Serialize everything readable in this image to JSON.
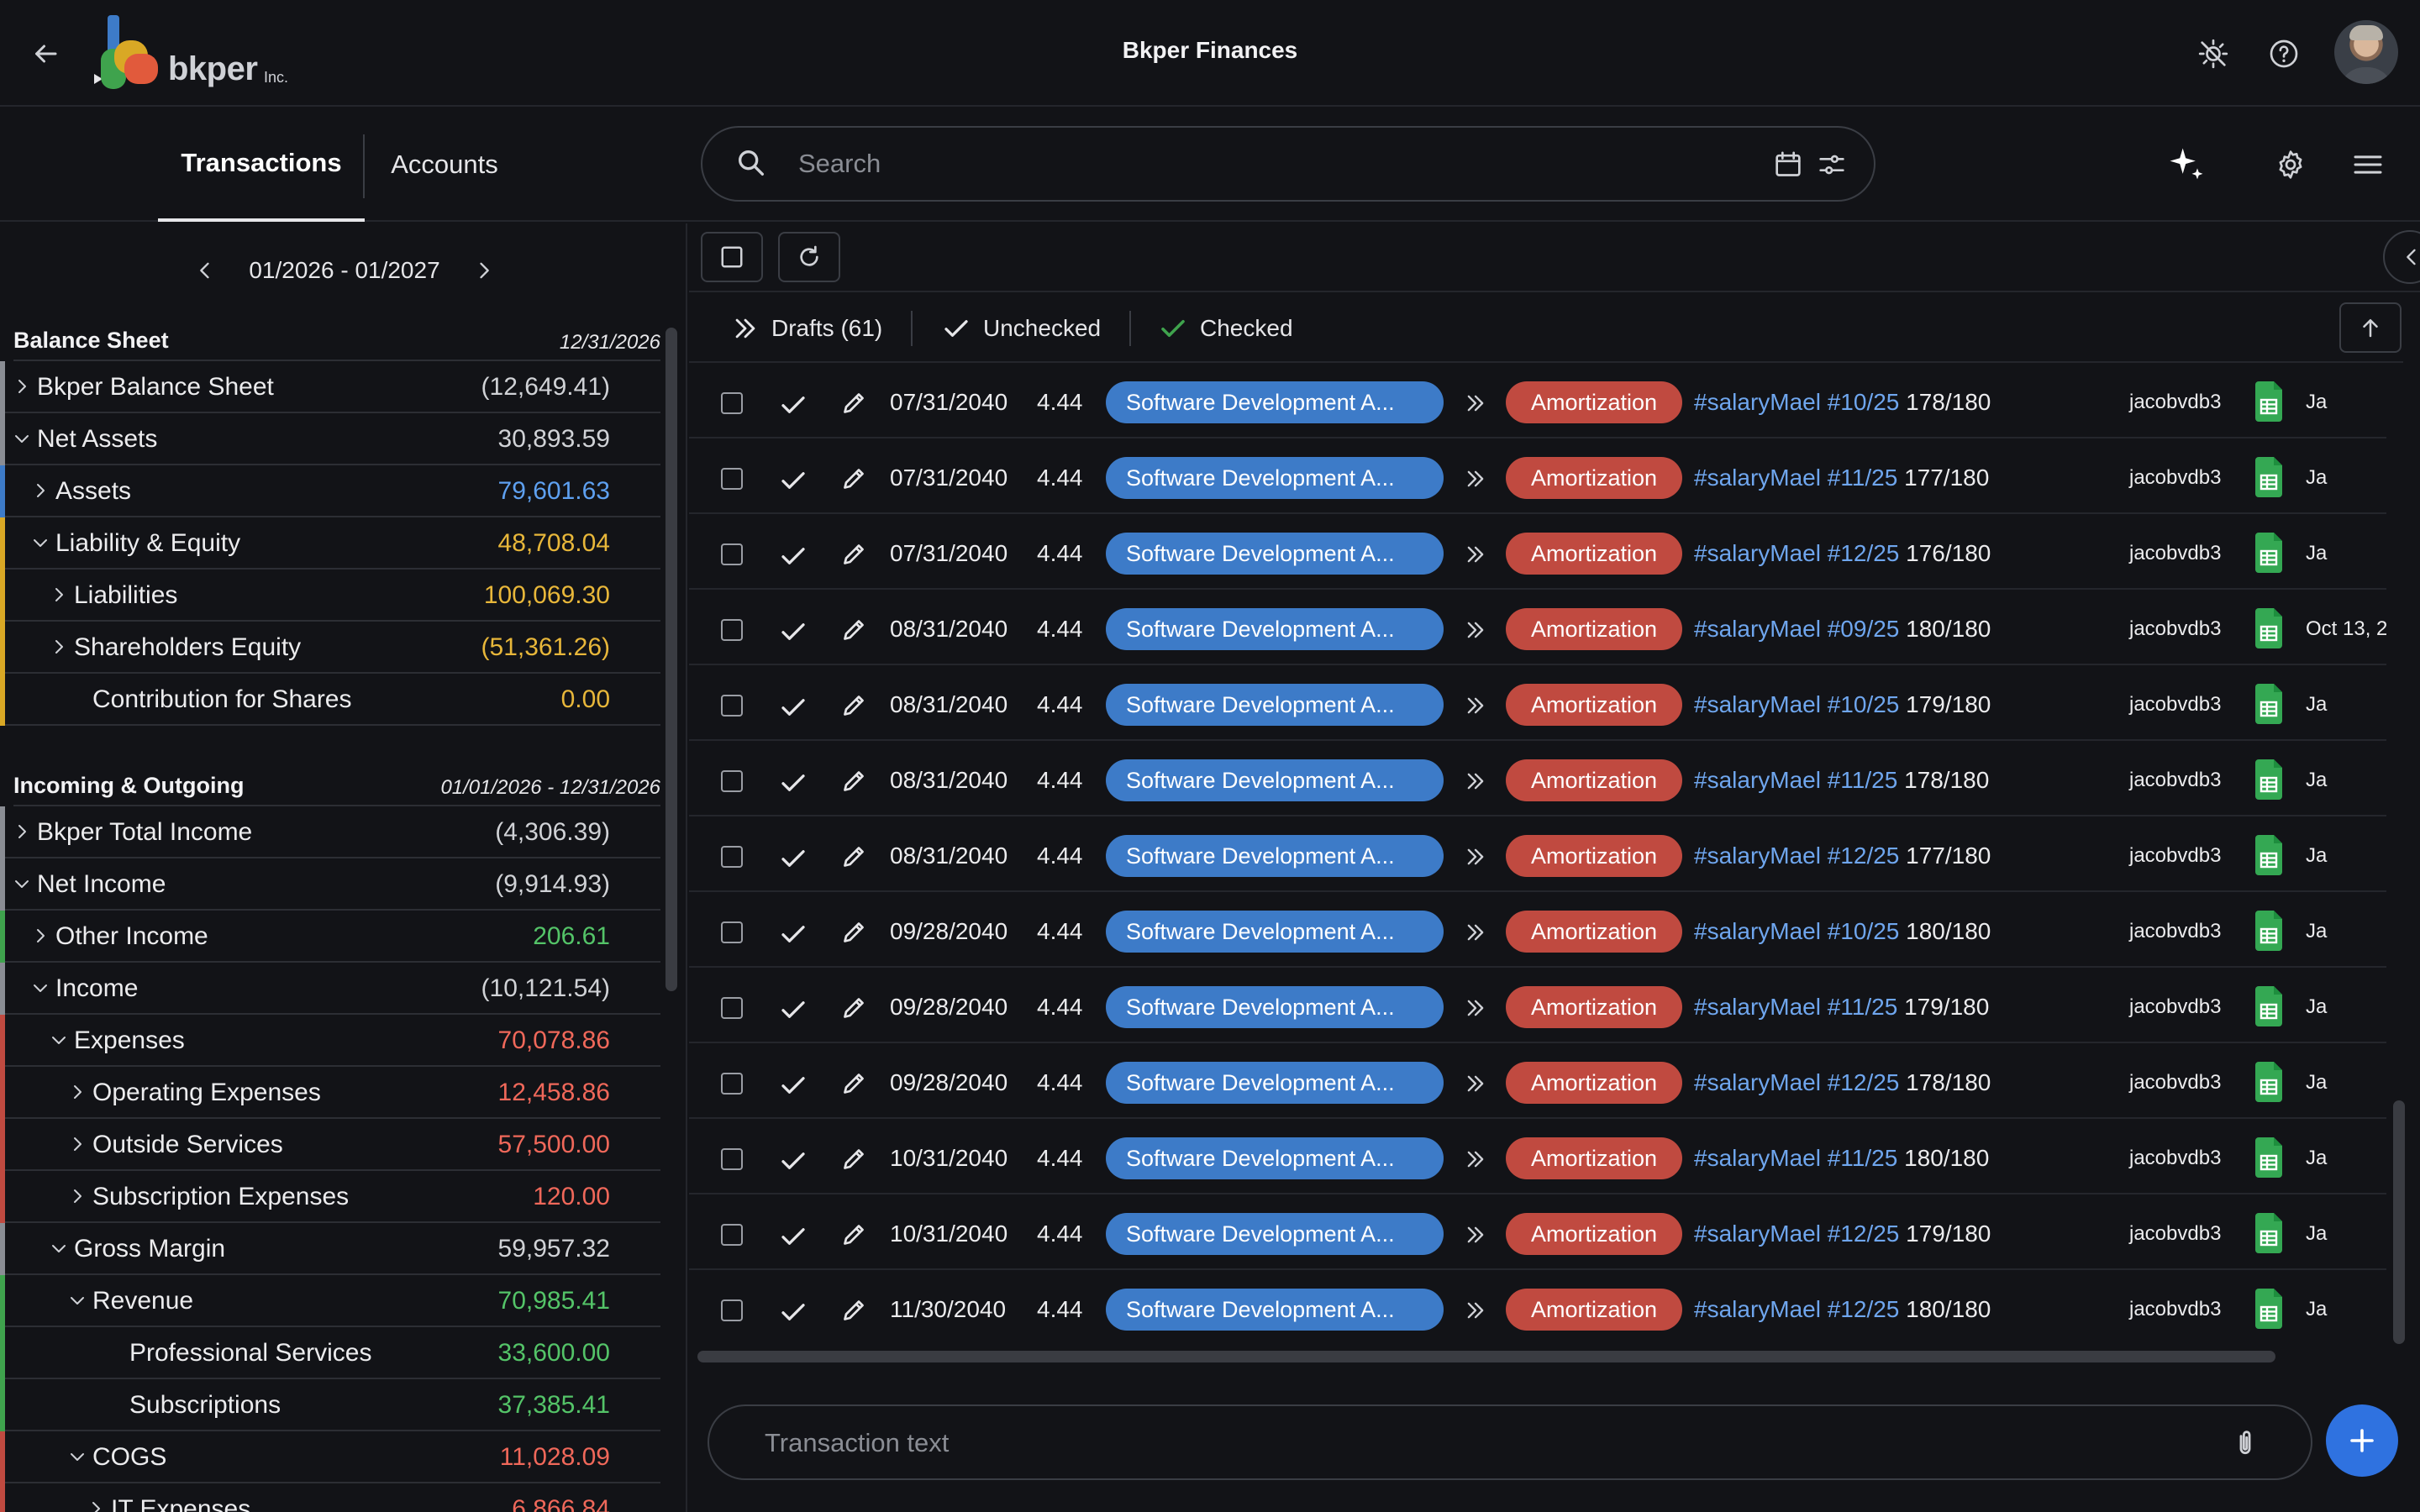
{
  "app": {
    "title": "Bkper Finances",
    "logo_word": "bkper",
    "logo_suffix": "Inc."
  },
  "tabs": {
    "transactions": "Transactions",
    "accounts": "Accounts"
  },
  "search": {
    "placeholder": "Search",
    "value": ""
  },
  "period": {
    "label": "01/2026 - 01/2027"
  },
  "balance_sheet": {
    "title": "Balance Sheet",
    "date": "12/31/2026",
    "accounts": [
      {
        "name": "Bkper Balance Sheet",
        "value": "(12,649.41)",
        "level": 0,
        "chevron": "right",
        "bar_color": "#8a8d94",
        "value_color": "#d0d2d6"
      },
      {
        "name": "Net Assets",
        "value": "30,893.59",
        "level": 0,
        "chevron": "down",
        "bar_color": "#8a8d94",
        "value_color": "#d0d2d6"
      },
      {
        "name": "Assets",
        "value": "79,601.63",
        "level": 1,
        "chevron": "right",
        "bar_color": "#3d7bc8",
        "value_color": "#5ea0f0"
      },
      {
        "name": "Liability & Equity",
        "value": "48,708.04",
        "level": 1,
        "chevron": "down",
        "bar_color": "#d9a825",
        "value_color": "#e8b73a"
      },
      {
        "name": "Liabilities",
        "value": "100,069.30",
        "level": 2,
        "chevron": "right",
        "bar_color": "#d9a825",
        "value_color": "#e8b73a"
      },
      {
        "name": "Shareholders Equity",
        "value": "(51,361.26)",
        "level": 2,
        "chevron": "right",
        "bar_color": "#d9a825",
        "value_color": "#e8b73a"
      },
      {
        "name": "Contribution for Shares",
        "value": "0.00",
        "level": 3,
        "chevron": "none",
        "bar_color": "#d9a825",
        "value_color": "#e8b73a"
      }
    ]
  },
  "incoming_outgoing": {
    "title": "Incoming & Outgoing",
    "date": "01/01/2026 - 12/31/2026",
    "accounts": [
      {
        "name": "Bkper Total Income",
        "value": "(4,306.39)",
        "level": 0,
        "chevron": "right",
        "bar_color": "#8a8d94",
        "value_color": "#d0d2d6"
      },
      {
        "name": "Net Income",
        "value": "(9,914.93)",
        "level": 0,
        "chevron": "down",
        "bar_color": "#8a8d94",
        "value_color": "#d0d2d6"
      },
      {
        "name": "Other Income",
        "value": "206.61",
        "level": 1,
        "chevron": "right",
        "bar_color": "#3fa34d",
        "value_color": "#54c468"
      },
      {
        "name": "Income",
        "value": "(10,121.54)",
        "level": 1,
        "chevron": "down",
        "bar_color": "#8a8d94",
        "value_color": "#d0d2d6"
      },
      {
        "name": "Expenses",
        "value": "70,078.86",
        "level": 2,
        "chevron": "down",
        "bar_color": "#c04a40",
        "value_color": "#f0685a"
      },
      {
        "name": "Operating Expenses",
        "value": "12,458.86",
        "level": 3,
        "chevron": "right",
        "bar_color": "#c04a40",
        "value_color": "#f0685a"
      },
      {
        "name": "Outside Services",
        "value": "57,500.00",
        "level": 3,
        "chevron": "right",
        "bar_color": "#c04a40",
        "value_color": "#f0685a"
      },
      {
        "name": "Subscription Expenses",
        "value": "120.00",
        "level": 3,
        "chevron": "right",
        "bar_color": "#c04a40",
        "value_color": "#f0685a"
      },
      {
        "name": "Gross Margin",
        "value": "59,957.32",
        "level": 2,
        "chevron": "down",
        "bar_color": "#8a8d94",
        "value_color": "#d0d2d6"
      },
      {
        "name": "Revenue",
        "value": "70,985.41",
        "level": 3,
        "chevron": "down",
        "bar_color": "#3fa34d",
        "value_color": "#54c468"
      },
      {
        "name": "Professional Services",
        "value": "33,600.00",
        "level": 5,
        "chevron": "none",
        "bar_color": "#3fa34d",
        "value_color": "#54c468"
      },
      {
        "name": "Subscriptions",
        "value": "37,385.41",
        "level": 5,
        "chevron": "none",
        "bar_color": "#3fa34d",
        "value_color": "#54c468"
      },
      {
        "name": "COGS",
        "value": "11,028.09",
        "level": 3,
        "chevron": "down",
        "bar_color": "#c04a40",
        "value_color": "#f0685a"
      },
      {
        "name": "IT Expenses",
        "value": "6,866.84",
        "level": 4,
        "chevron": "right",
        "bar_color": "#c04a40",
        "value_color": "#f0685a"
      }
    ]
  },
  "filters": {
    "drafts": "Drafts (61)",
    "unchecked": "Unchecked",
    "checked": "Checked"
  },
  "transactions": [
    {
      "date": "07/31/2040",
      "amount": "4.44",
      "from": "Software Development A...",
      "to": "Amortization",
      "tag1": "#salaryMael",
      "tag2": "#10/25",
      "frac": "178/180",
      "user": "jacobvdb3",
      "extra": "Ja"
    },
    {
      "date": "07/31/2040",
      "amount": "4.44",
      "from": "Software Development A...",
      "to": "Amortization",
      "tag1": "#salaryMael",
      "tag2": "#11/25",
      "frac": "177/180",
      "user": "jacobvdb3",
      "extra": "Ja"
    },
    {
      "date": "07/31/2040",
      "amount": "4.44",
      "from": "Software Development A...",
      "to": "Amortization",
      "tag1": "#salaryMael",
      "tag2": "#12/25",
      "frac": "176/180",
      "user": "jacobvdb3",
      "extra": "Ja"
    },
    {
      "date": "08/31/2040",
      "amount": "4.44",
      "from": "Software Development A...",
      "to": "Amortization",
      "tag1": "#salaryMael",
      "tag2": "#09/25",
      "frac": "180/180",
      "user": "jacobvdb3",
      "extra": "Oct 13, 2"
    },
    {
      "date": "08/31/2040",
      "amount": "4.44",
      "from": "Software Development A...",
      "to": "Amortization",
      "tag1": "#salaryMael",
      "tag2": "#10/25",
      "frac": "179/180",
      "user": "jacobvdb3",
      "extra": "Ja"
    },
    {
      "date": "08/31/2040",
      "amount": "4.44",
      "from": "Software Development A...",
      "to": "Amortization",
      "tag1": "#salaryMael",
      "tag2": "#11/25",
      "frac": "178/180",
      "user": "jacobvdb3",
      "extra": "Ja"
    },
    {
      "date": "08/31/2040",
      "amount": "4.44",
      "from": "Software Development A...",
      "to": "Amortization",
      "tag1": "#salaryMael",
      "tag2": "#12/25",
      "frac": "177/180",
      "user": "jacobvdb3",
      "extra": "Ja"
    },
    {
      "date": "09/28/2040",
      "amount": "4.44",
      "from": "Software Development A...",
      "to": "Amortization",
      "tag1": "#salaryMael",
      "tag2": "#10/25",
      "frac": "180/180",
      "user": "jacobvdb3",
      "extra": "Ja"
    },
    {
      "date": "09/28/2040",
      "amount": "4.44",
      "from": "Software Development A...",
      "to": "Amortization",
      "tag1": "#salaryMael",
      "tag2": "#11/25",
      "frac": "179/180",
      "user": "jacobvdb3",
      "extra": "Ja"
    },
    {
      "date": "09/28/2040",
      "amount": "4.44",
      "from": "Software Development A...",
      "to": "Amortization",
      "tag1": "#salaryMael",
      "tag2": "#12/25",
      "frac": "178/180",
      "user": "jacobvdb3",
      "extra": "Ja"
    },
    {
      "date": "10/31/2040",
      "amount": "4.44",
      "from": "Software Development A...",
      "to": "Amortization",
      "tag1": "#salaryMael",
      "tag2": "#11/25",
      "frac": "180/180",
      "user": "jacobvdb3",
      "extra": "Ja"
    },
    {
      "date": "10/31/2040",
      "amount": "4.44",
      "from": "Software Development A...",
      "to": "Amortization",
      "tag1": "#salaryMael",
      "tag2": "#12/25",
      "frac": "179/180",
      "user": "jacobvdb3",
      "extra": "Ja"
    },
    {
      "date": "11/30/2040",
      "amount": "4.44",
      "from": "Software Development A...",
      "to": "Amortization",
      "tag1": "#salaryMael",
      "tag2": "#12/25",
      "frac": "180/180",
      "user": "jacobvdb3",
      "extra": "Ja"
    }
  ],
  "tx_input": {
    "placeholder": "Transaction text"
  },
  "colors": {
    "background": "#121317",
    "accent": "#2f72e0",
    "from_chip": "#3d7bc8",
    "to_chip": "#c04a40",
    "hashtag": "#6fa6ee",
    "check_green": "#3fa34d"
  },
  "icons": [
    "back-arrow-icon",
    "theme-toggle-icon",
    "help-icon",
    "search-icon",
    "calendar-icon",
    "filter-icon",
    "sparkle-icon",
    "gear-icon",
    "menu-icon",
    "checkbox-icon",
    "refresh-icon",
    "chevron-left-icon",
    "double-chevron-icon",
    "check-icon",
    "pencil-icon",
    "sheet-icon",
    "arrow-up-icon",
    "attach-icon",
    "plus-icon"
  ]
}
